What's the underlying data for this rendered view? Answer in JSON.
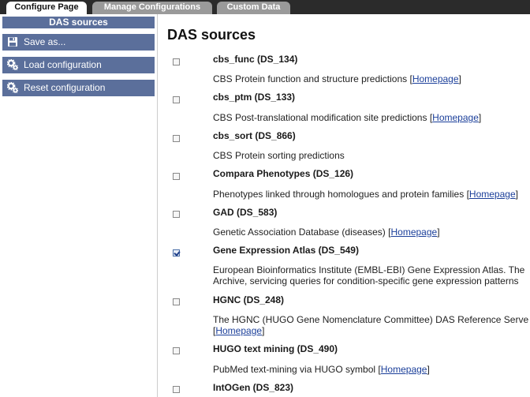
{
  "tabs": [
    {
      "label": "Configure Page",
      "active": true
    },
    {
      "label": "Manage Configurations",
      "active": false
    },
    {
      "label": "Custom Data",
      "active": false
    }
  ],
  "sidebar": {
    "header": "DAS sources",
    "buttons": {
      "save": "Save as...",
      "load": "Load configuration",
      "reset": "Reset configuration"
    }
  },
  "main": {
    "title": "DAS sources",
    "homepage_label": "Homepage",
    "sources": [
      {
        "name": "cbs_func (DS_134)",
        "checked": false,
        "desc": "CBS Protein function and structure predictions",
        "homepage": true
      },
      {
        "name": "cbs_ptm (DS_133)",
        "checked": false,
        "desc": "CBS Post-translational modification site predictions",
        "homepage": true
      },
      {
        "name": "cbs_sort (DS_866)",
        "checked": false,
        "desc": "CBS Protein sorting predictions",
        "homepage": false
      },
      {
        "name": "Compara Phenotypes (DS_126)",
        "checked": false,
        "desc": "Phenotypes linked through homologues and protein families",
        "homepage": true
      },
      {
        "name": "GAD (DS_583)",
        "checked": false,
        "desc": "Genetic Association Database (diseases)",
        "homepage": true
      },
      {
        "name": "Gene Expression Atlas (DS_549)",
        "checked": true,
        "desc": "European Bioinformatics Institute (EMBL-EBI) Gene  Expression Atlas. The",
        "desc2": "Archive, servicing queries for  condition-specific gene expression patterns",
        "homepage": false
      },
      {
        "name": "HGNC (DS_248)",
        "checked": false,
        "desc": "The HGNC (HUGO Gene Nomenclature Committee) DAS Reference Serve",
        "homepage": true,
        "homepage_newline": true
      },
      {
        "name": "HUGO text mining (DS_490)",
        "checked": false,
        "desc": "PubMed text-mining via HUGO symbol",
        "homepage": true
      },
      {
        "name": "IntOGen (DS_823)",
        "checked": false,
        "desc": "",
        "homepage": false
      }
    ]
  }
}
